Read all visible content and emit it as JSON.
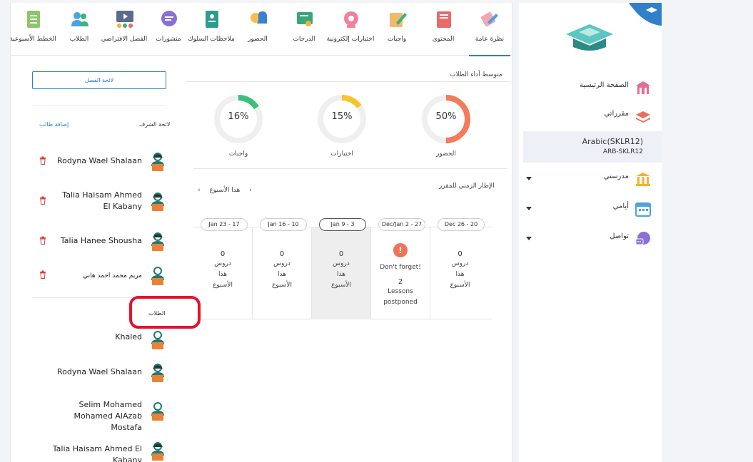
{
  "tabs": [
    {
      "label": "نظرة عامة",
      "icon": "overview-icon",
      "active": true
    },
    {
      "label": "المحتوى",
      "icon": "content-book-icon"
    },
    {
      "label": "واجبات",
      "icon": "homework-pencil-icon"
    },
    {
      "label": "اختبارات إلكترونية",
      "icon": "e-exam-icon"
    },
    {
      "label": "الدرجات",
      "icon": "grades-certificate-icon"
    },
    {
      "label": "الحضور",
      "icon": "attendance-bell-icon"
    },
    {
      "label": "ملاحظات السلوك",
      "icon": "behavior-notes-icon"
    },
    {
      "label": "منشورات",
      "icon": "posts-chat-icon"
    },
    {
      "label": "الفصل الافتراضي",
      "icon": "virtual-class-icon"
    },
    {
      "label": "الطلاب",
      "icon": "students-icon"
    },
    {
      "label": "الخطط الأسبوعية",
      "icon": "weekly-plans-icon"
    }
  ],
  "performance": {
    "title": "متوسط أداء الطلاب",
    "donuts": [
      {
        "label": "الحضور",
        "value": "50%",
        "fraction": 0.5,
        "color": "#f47b5c"
      },
      {
        "label": "اختبارات",
        "value": "15%",
        "fraction": 0.15,
        "color": "#f8c42d"
      },
      {
        "label": "واجبات",
        "value": "16%",
        "fraction": 0.16,
        "color": "#3bc07c"
      }
    ]
  },
  "timeline": {
    "title": "الإطار الزمني للمقرر",
    "this_week": "هذا الأسبوع",
    "weeks": [
      {
        "range": "Dec 26 - 20",
        "count": "0",
        "lines": [
          "دروس",
          "هذا",
          "الأسبوع"
        ]
      },
      {
        "range": "Dec/Jan 2 - 27",
        "dont_forget": "Don't forget!",
        "count": "2",
        "lines": [
          "Lessons",
          "postponed"
        ]
      },
      {
        "range": "Jan 9 - 3",
        "count": "0",
        "lines": [
          "دروس",
          "هذا",
          "الأسبوع"
        ],
        "current": true
      },
      {
        "range": "Jan 16 - 10",
        "count": "0",
        "lines": [
          "دروس",
          "هذا",
          "الأسبوع"
        ]
      },
      {
        "range": "Jan 23 - 17",
        "count": "0",
        "lines": [
          "دروس",
          "هذا",
          "الأسبوع"
        ]
      }
    ]
  },
  "left": {
    "class_list_button": "لائحة الفصل",
    "supervision_title": "لائحة الشرف",
    "add_student": "إضافة طالب",
    "honor_list": [
      {
        "name": "Rodyna Wael Shalaan"
      },
      {
        "name": "Talia Haisam Ahmed El Kabany"
      },
      {
        "name": "Talia Hanee Shousha"
      },
      {
        "name": "مريم محمد احمد هاني"
      }
    ],
    "students_title": "الطلاب",
    "students": [
      {
        "name": "Khaled"
      },
      {
        "name": "Rodyna Wael Shalaan"
      },
      {
        "name": "Selim Mohamed Mohamed AlAzab Mostafa"
      },
      {
        "name": "Talia Haisam Ahmed El Kabany"
      }
    ]
  },
  "sidebar": {
    "items": [
      {
        "label": "الصفحة الرئيسية",
        "icon": "home-icon"
      },
      {
        "label": "مقرراتي",
        "icon": "courses-stack-icon"
      },
      {
        "label": "مدرستي",
        "icon": "school-building-icon"
      },
      {
        "label": "أيامي",
        "icon": "calendar-icon"
      },
      {
        "label": "تواصل",
        "icon": "communicate-chat-icon"
      }
    ],
    "course": {
      "title": "Arabic(SKLR12)",
      "code": "ARB-SKLR12"
    }
  }
}
